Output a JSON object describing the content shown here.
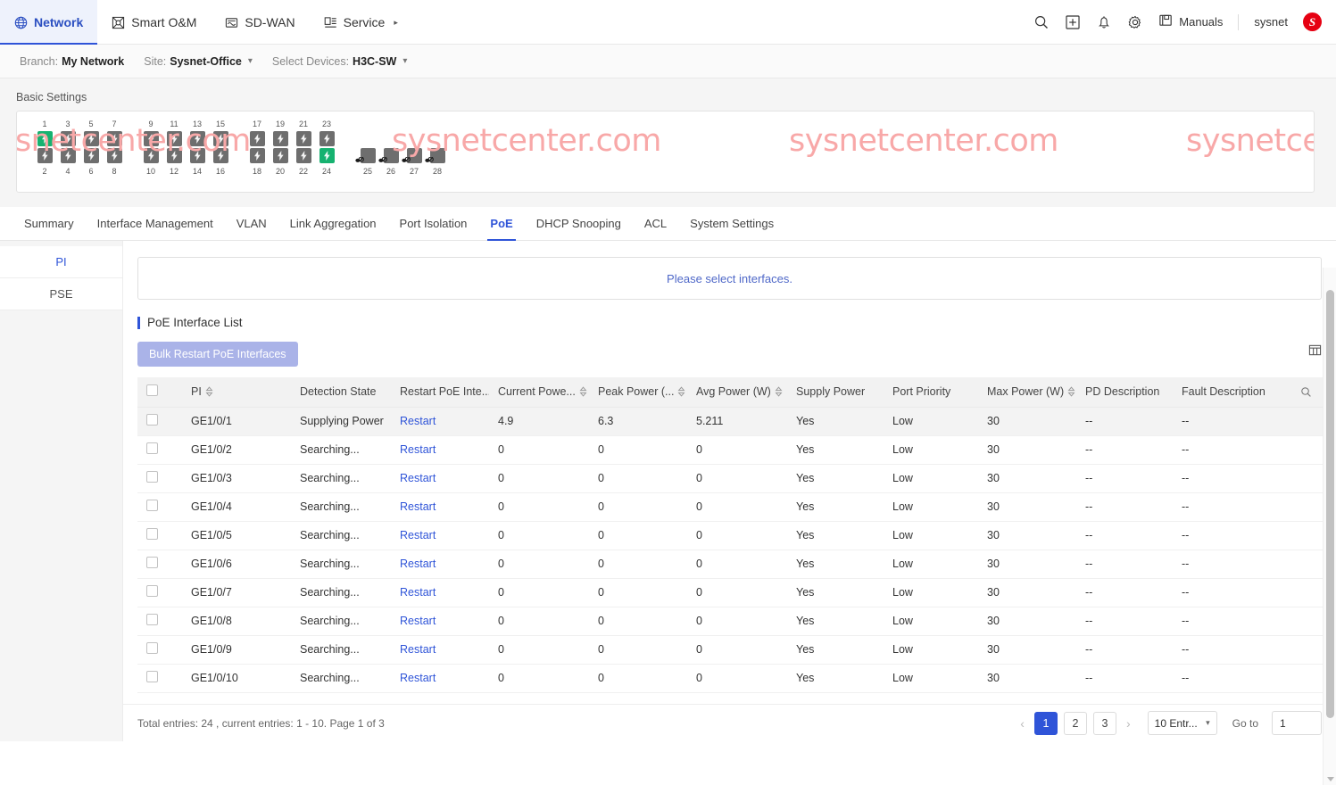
{
  "topnav": {
    "items": [
      {
        "label": "Network",
        "icon": "globe-icon",
        "active": true
      },
      {
        "label": "Smart O&M",
        "icon": "smart-om-icon",
        "active": false
      },
      {
        "label": "SD-WAN",
        "icon": "sdwan-icon",
        "active": false
      },
      {
        "label": "Service",
        "icon": "service-icon",
        "active": false,
        "caret": "▸"
      }
    ],
    "right": {
      "search_icon": "search-icon",
      "add_icon": "add-box-icon",
      "bell_icon": "notification-bell-icon",
      "gear_icon": "settings-gear-icon",
      "manuals_label": "Manuals",
      "manuals_icon": "manuals-book-icon",
      "user_name": "sysnet",
      "user_logo_text": "S",
      "user_logo_color": "#e60012"
    }
  },
  "breadcrumb": {
    "branch_label": "Branch:",
    "branch_value": "My Network",
    "site_label": "Site:",
    "site_value": "Sysnet-Office",
    "devices_label": "Select Devices:",
    "devices_value": "H3C-SW"
  },
  "basic_settings": {
    "label": "Basic Settings",
    "watermark_text": "sysnetcenter.com",
    "watermark_color": "#f8a8a8",
    "ports": {
      "top_row": [
        1,
        3,
        5,
        7,
        9,
        11,
        13,
        15,
        17,
        19,
        21,
        23
      ],
      "bottom_row": [
        2,
        4,
        6,
        8,
        10,
        12,
        14,
        16,
        18,
        20,
        22,
        24
      ],
      "sfp_row": [
        25,
        26,
        27,
        28
      ],
      "active_ports": [
        1,
        24
      ],
      "active_color": "#16b270",
      "inactive_color": "#6e6e6e"
    }
  },
  "tabs": [
    {
      "label": "Summary",
      "active": false
    },
    {
      "label": "Interface Management",
      "active": false
    },
    {
      "label": "VLAN",
      "active": false
    },
    {
      "label": "Link Aggregation",
      "active": false
    },
    {
      "label": "Port Isolation",
      "active": false
    },
    {
      "label": "PoE",
      "active": true
    },
    {
      "label": "DHCP Snooping",
      "active": false
    },
    {
      "label": "ACL",
      "active": false
    },
    {
      "label": "System Settings",
      "active": false
    }
  ],
  "sidebar": {
    "items": [
      {
        "label": "PI",
        "active": true
      },
      {
        "label": "PSE",
        "active": false
      }
    ]
  },
  "main": {
    "notice": "Please select interfaces.",
    "section_title": "PoE Interface List",
    "bulk_button": "Bulk Restart PoE Interfaces",
    "columns_icon": "column-settings-icon",
    "search_icon": "table-search-icon",
    "columns": [
      {
        "key": "pi",
        "label": "PI",
        "sortable": true
      },
      {
        "key": "detection",
        "label": "Detection State",
        "sortable": false
      },
      {
        "key": "restart",
        "label": "Restart PoE Inte...",
        "sortable": false
      },
      {
        "key": "current",
        "label": "Current Powe...",
        "sortable": true
      },
      {
        "key": "peak",
        "label": "Peak Power (...",
        "sortable": true
      },
      {
        "key": "avg",
        "label": "Avg Power (W)",
        "sortable": true
      },
      {
        "key": "supply",
        "label": "Supply Power",
        "sortable": false
      },
      {
        "key": "priority",
        "label": "Port Priority",
        "sortable": false
      },
      {
        "key": "max",
        "label": "Max Power (W)",
        "sortable": true
      },
      {
        "key": "pd",
        "label": "PD Description",
        "sortable": false
      },
      {
        "key": "fault",
        "label": "Fault Description",
        "sortable": false
      }
    ],
    "rows": [
      {
        "pi": "GE1/0/1",
        "detection": "Supplying Power",
        "restart": "Restart",
        "current": "4.9",
        "peak": "6.3",
        "avg": "5.211",
        "supply": "Yes",
        "priority": "Low",
        "max": "30",
        "pd": "--",
        "fault": "--",
        "highlight": true
      },
      {
        "pi": "GE1/0/2",
        "detection": "Searching...",
        "restart": "Restart",
        "current": "0",
        "peak": "0",
        "avg": "0",
        "supply": "Yes",
        "priority": "Low",
        "max": "30",
        "pd": "--",
        "fault": "--",
        "highlight": false
      },
      {
        "pi": "GE1/0/3",
        "detection": "Searching...",
        "restart": "Restart",
        "current": "0",
        "peak": "0",
        "avg": "0",
        "supply": "Yes",
        "priority": "Low",
        "max": "30",
        "pd": "--",
        "fault": "--",
        "highlight": false
      },
      {
        "pi": "GE1/0/4",
        "detection": "Searching...",
        "restart": "Restart",
        "current": "0",
        "peak": "0",
        "avg": "0",
        "supply": "Yes",
        "priority": "Low",
        "max": "30",
        "pd": "--",
        "fault": "--",
        "highlight": false
      },
      {
        "pi": "GE1/0/5",
        "detection": "Searching...",
        "restart": "Restart",
        "current": "0",
        "peak": "0",
        "avg": "0",
        "supply": "Yes",
        "priority": "Low",
        "max": "30",
        "pd": "--",
        "fault": "--",
        "highlight": false
      },
      {
        "pi": "GE1/0/6",
        "detection": "Searching...",
        "restart": "Restart",
        "current": "0",
        "peak": "0",
        "avg": "0",
        "supply": "Yes",
        "priority": "Low",
        "max": "30",
        "pd": "--",
        "fault": "--",
        "highlight": false
      },
      {
        "pi": "GE1/0/7",
        "detection": "Searching...",
        "restart": "Restart",
        "current": "0",
        "peak": "0",
        "avg": "0",
        "supply": "Yes",
        "priority": "Low",
        "max": "30",
        "pd": "--",
        "fault": "--",
        "highlight": false
      },
      {
        "pi": "GE1/0/8",
        "detection": "Searching...",
        "restart": "Restart",
        "current": "0",
        "peak": "0",
        "avg": "0",
        "supply": "Yes",
        "priority": "Low",
        "max": "30",
        "pd": "--",
        "fault": "--",
        "highlight": false
      },
      {
        "pi": "GE1/0/9",
        "detection": "Searching...",
        "restart": "Restart",
        "current": "0",
        "peak": "0",
        "avg": "0",
        "supply": "Yes",
        "priority": "Low",
        "max": "30",
        "pd": "--",
        "fault": "--",
        "highlight": false
      },
      {
        "pi": "GE1/0/10",
        "detection": "Searching...",
        "restart": "Restart",
        "current": "0",
        "peak": "0",
        "avg": "0",
        "supply": "Yes",
        "priority": "Low",
        "max": "30",
        "pd": "--",
        "fault": "--",
        "highlight": false
      }
    ]
  },
  "footer": {
    "total_text": "Total entries: 24 , current entries: 1 - 10. Page 1 of 3",
    "prev_arrow": "‹",
    "next_arrow": "›",
    "pages": [
      "1",
      "2",
      "3"
    ],
    "current_page": "1",
    "page_size_label": "10 Entr...",
    "goto_label": "Go to",
    "goto_value": "1"
  }
}
